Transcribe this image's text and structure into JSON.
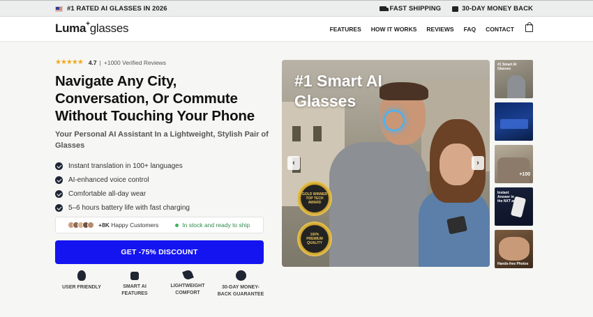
{
  "topbar": {
    "left_text": "#1 RATED AI GLASSES IN 2026",
    "shipping": "FAST SHIPPING",
    "guarantee": "30-DAY MONEY BACK"
  },
  "header": {
    "logo_main": "Luma",
    "logo_sup": "+",
    "logo_rest": "glasses",
    "nav": [
      "FEATURES",
      "HOW IT WORKS",
      "REVIEWS",
      "FAQ",
      "CONTACT"
    ]
  },
  "rating": {
    "stars": "★★★★★",
    "score": "4.7",
    "divider": "|",
    "reviews": "+1000 Verified Reviews"
  },
  "headline": "Navigate Any City, Conversation, Or Commute Without Touching Your Phone",
  "subheadline": "Your Personal AI Assistant In a Lightweight, Stylish Pair of Glasses",
  "features": [
    "Instant translation in 100+ languages",
    "AI-enhanced voice control",
    "Comfortable all-day wear",
    "5–6 hours battery life with fast charging"
  ],
  "social_proof": {
    "customers_count": "+8K",
    "customers_label": "Happy Customers",
    "stock": "In stock and ready to ship"
  },
  "cta": "GET -75% DISCOUNT",
  "badges": [
    {
      "line1": "USER FRIENDLY",
      "line2": ""
    },
    {
      "line1": "SMART AI",
      "line2": "FEATURES"
    },
    {
      "line1": "LIGHTWEIGHT",
      "line2": "COMFORT"
    },
    {
      "line1": "30-DAY MONEY-",
      "line2": "BACK GUARANTEE"
    }
  ],
  "hero": {
    "title": "#1 Smart AI Glasses",
    "prev": "‹",
    "next": "›",
    "award1": [
      "GOLD WINNER",
      "TOP TECH",
      "AWARD"
    ],
    "award2": [
      "100%",
      "PREMIUM",
      "QUALITY"
    ]
  },
  "thumbnails": {
    "t1": "#1 Smart AI Glasses",
    "t3": "+100",
    "t4": "Instant Answer in the NXT app",
    "t5": "Hands-free Photos"
  },
  "colors": {
    "cta": "#1414f0",
    "stars": "#f2a91a",
    "stock": "#2f8a4a"
  }
}
